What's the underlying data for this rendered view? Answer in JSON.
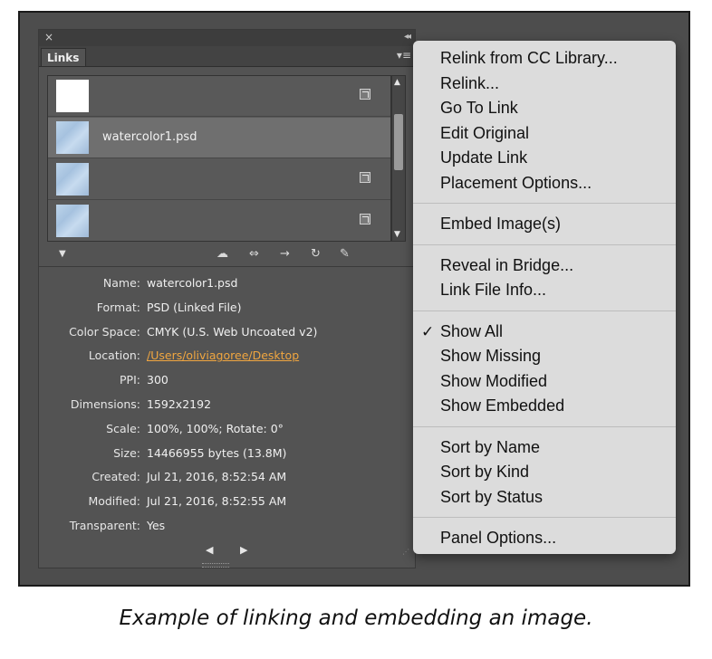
{
  "panel": {
    "close_glyph": "×",
    "collapse_glyph": "◂◂",
    "tab_label": "Links",
    "menu_glyph": "▾≡"
  },
  "links_list": {
    "rows": [
      {
        "label": "",
        "thumb": "white",
        "status": "modified-link-icon",
        "selected": false
      },
      {
        "label": "watercolor1.psd",
        "thumb": "watercolor",
        "status": "",
        "selected": true
      },
      {
        "label": "",
        "thumb": "watercolor",
        "status": "modified-link-icon",
        "selected": false
      },
      {
        "label": "",
        "thumb": "watercolor",
        "status": "modified-link-icon",
        "selected": false
      }
    ],
    "scroll_up_glyph": "▲",
    "scroll_down_glyph": "▼"
  },
  "toolbar": {
    "disclosure_glyph": "▼",
    "icons": [
      "cc-library-icon",
      "relink-icon",
      "go-to-link-icon",
      "update-link-icon",
      "edit-original-icon"
    ],
    "glyphs": [
      "☁",
      "⇔",
      "→",
      "↻",
      "✎"
    ]
  },
  "link_info": [
    {
      "label": "Name:",
      "value": "watercolor1.psd"
    },
    {
      "label": "Format:",
      "value": "PSD (Linked File)"
    },
    {
      "label": "Color Space:",
      "value": "CMYK (U.S. Web Uncoated v2)"
    },
    {
      "label": "Location:",
      "value": "/Users/oliviagoree/Desktop",
      "is_link": true
    },
    {
      "label": "PPI:",
      "value": "300"
    },
    {
      "label": "Dimensions:",
      "value": "1592x2192"
    },
    {
      "label": "Scale:",
      "value": "100%, 100%; Rotate: 0°"
    },
    {
      "label": "Size:",
      "value": "14466955 bytes (13.8M)"
    },
    {
      "label": "Created:",
      "value": "Jul 21, 2016, 8:52:54 AM"
    },
    {
      "label": "Modified:",
      "value": "Jul 21, 2016, 8:52:55 AM"
    },
    {
      "label": "Transparent:",
      "value": "Yes"
    }
  ],
  "footer": {
    "prev_glyph": "◀",
    "next_glyph": "▶",
    "grip_glyph": "⋰"
  },
  "context_menu": {
    "groups": [
      [
        "Relink from CC Library...",
        "Relink...",
        "Go To Link",
        "Edit Original",
        "Update Link",
        "Placement Options..."
      ],
      [
        "Embed Image(s)"
      ],
      [
        "Reveal in Bridge...",
        "Link File Info..."
      ],
      [
        "Show All",
        "Show Missing",
        "Show Modified",
        "Show Embedded"
      ],
      [
        "Sort by Name",
        "Sort by Kind",
        "Sort by Status"
      ],
      [
        "Panel Options..."
      ]
    ],
    "checked_item": "Show All",
    "check_glyph": "✓"
  },
  "caption": "Example of linking and embedding an image.",
  "colors": {
    "panel_bg": "#535353",
    "menu_bg": "#dcdcdc",
    "link_color": "#f0a640",
    "selected_row": "#6f6f6f"
  }
}
